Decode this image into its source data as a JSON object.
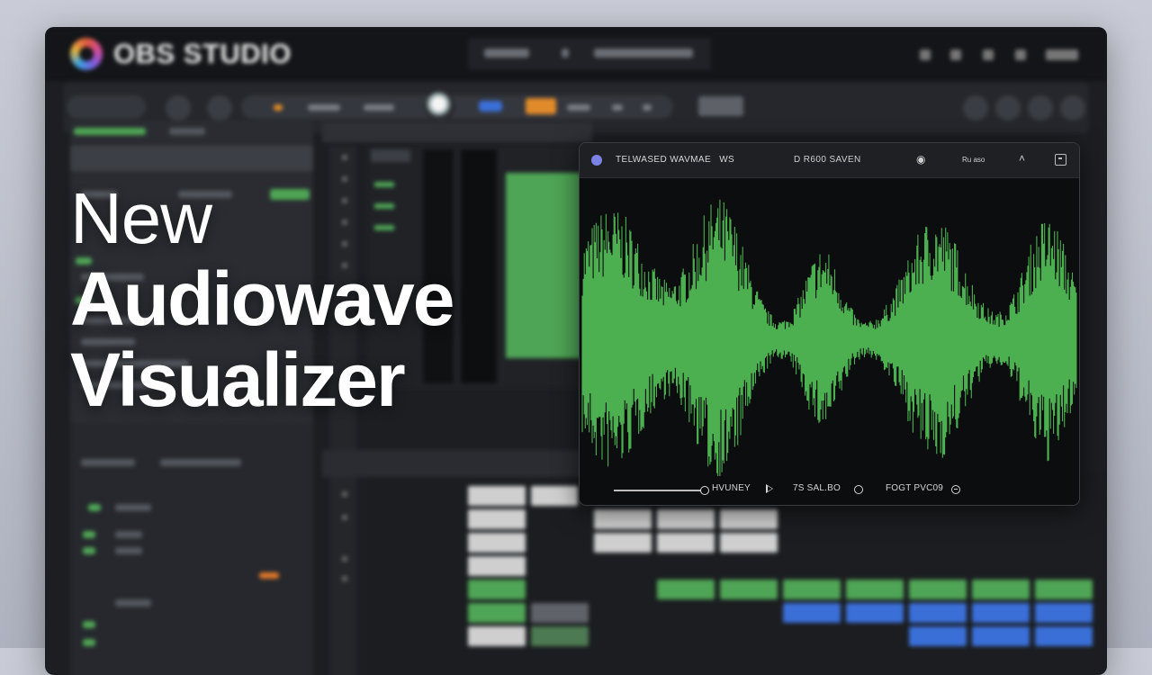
{
  "app": {
    "brand_name": "OBS STUDIO"
  },
  "headline": {
    "line1": "New",
    "line2": "Audiowave",
    "line3": "Visualizer"
  },
  "visualizer": {
    "title": "TELWASED WAVMAE",
    "badge": "WS",
    "mid_label": "D R600 SAVEN",
    "right_label": "Ru aso",
    "footer": {
      "label1": "HVUNEY",
      "label2": "7S SAL.BO",
      "label3": "FOGT PVC09"
    },
    "wave_color": "#4caf50"
  },
  "colors": {
    "accent_green": "#4fa556",
    "accent_blue": "#3b6fd8",
    "accent_orange": "#e08a2a",
    "panel_bg": "#0c0d0e"
  }
}
